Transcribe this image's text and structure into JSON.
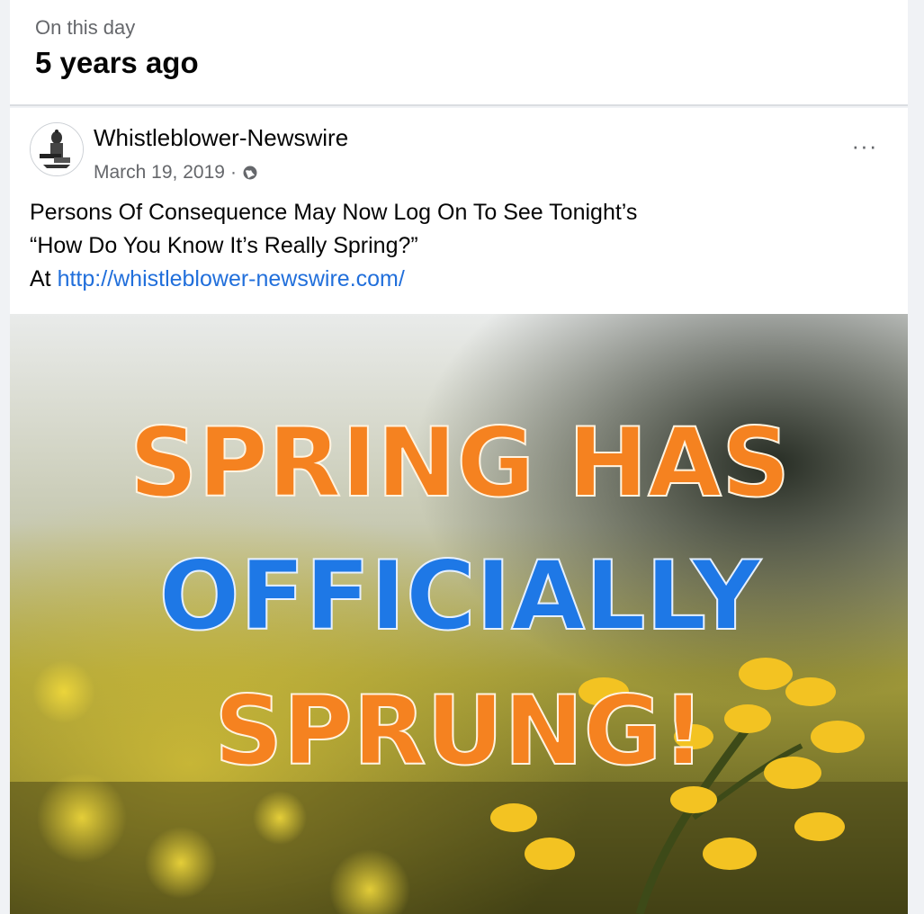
{
  "memory": {
    "label": "On this day",
    "title": "5 years ago"
  },
  "post": {
    "author": "Whistleblower-Newswire",
    "date": "March 19, 2019",
    "separator": "·",
    "privacy_icon": "globe-icon",
    "more_icon": "more-options-icon",
    "more_label": "···",
    "text": {
      "line1": "Persons Of Consequence May Now Log On To See Tonight’s",
      "line2": "“How Do You Know It’s Really Spring?”",
      "line3_prefix": "At",
      "link": "http://whistleblower-newswire.com/"
    },
    "image": {
      "line1": "SPRING HAS",
      "line2": "OFFICIALLY",
      "line3": "SPRUNG!"
    }
  },
  "colors": {
    "link": "#216fdb",
    "headline_orange": "#f58220",
    "headline_blue": "#1e78e6"
  }
}
